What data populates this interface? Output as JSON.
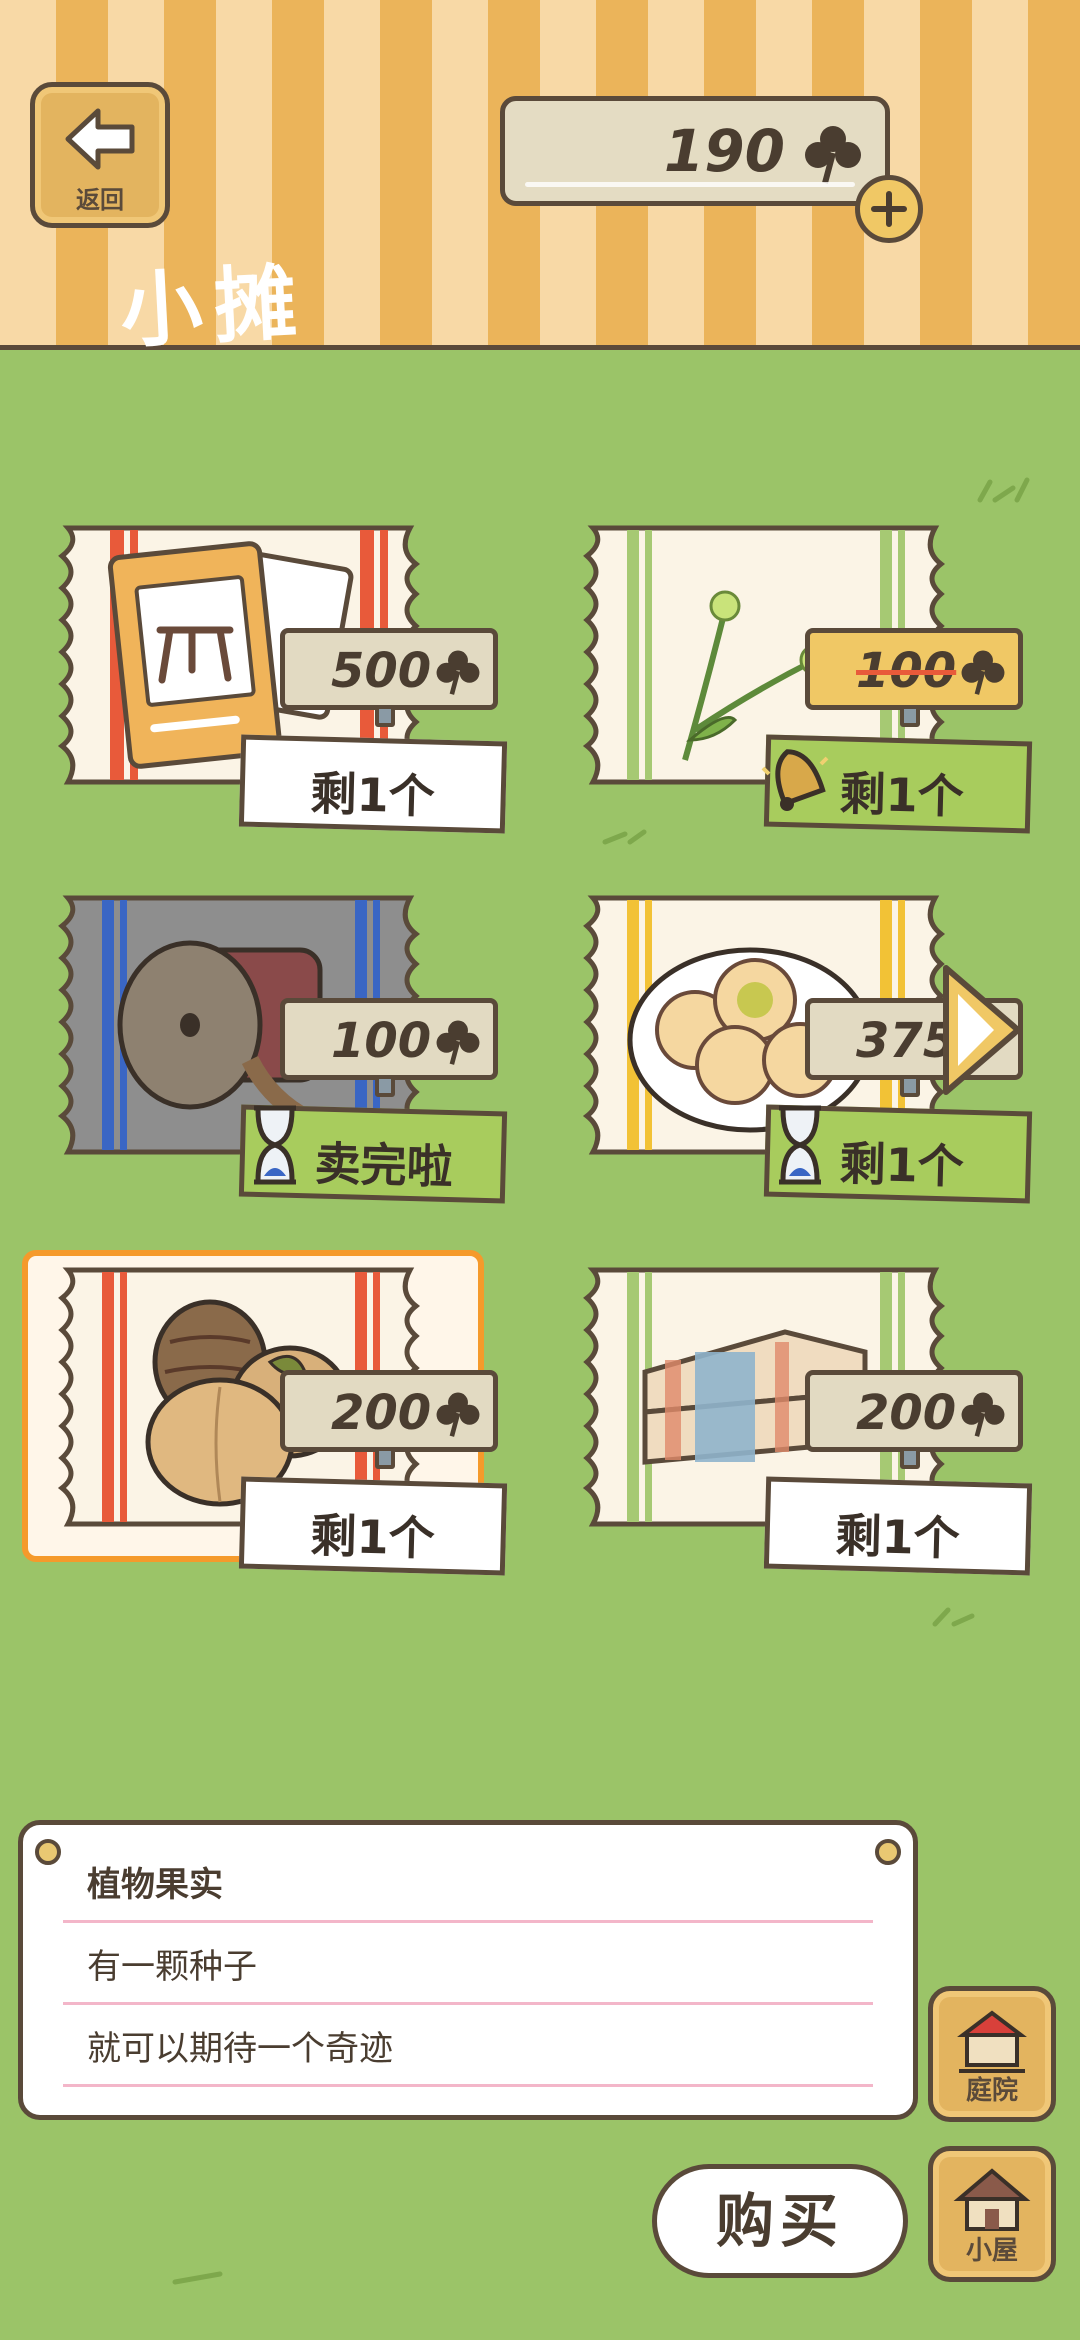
{
  "header": {
    "title": "小摊",
    "back_label": "返回",
    "currency_amount": "190"
  },
  "items": [
    {
      "id": "table-card",
      "price": "500",
      "stock_label": "剩1个",
      "cloth_color": "#e85a3a",
      "on_sale": false,
      "badge": "none",
      "selected": false
    },
    {
      "id": "dandelion",
      "price": "100",
      "stock_label": "剩1个",
      "cloth_color": "#a6c973",
      "on_sale": true,
      "badge": "bell-icon",
      "selected": false
    },
    {
      "id": "radish-wheel",
      "price": "100",
      "stock_label": "卖完啦",
      "cloth_color": "#3a66c4",
      "on_sale": false,
      "badge": "hourglass-icon",
      "selected": false
    },
    {
      "id": "dumplings",
      "price": "375",
      "stock_label": "剩1个",
      "cloth_color": "#f2c236",
      "on_sale": false,
      "badge": "hourglass-icon",
      "selected": false
    },
    {
      "id": "pinecone-fruit",
      "price": "200",
      "stock_label": "剩1个",
      "cloth_color": "#e85a3a",
      "on_sale": false,
      "badge": "none",
      "selected": true
    },
    {
      "id": "cushion",
      "price": "200",
      "stock_label": "剩1个",
      "cloth_color": "#a6c973",
      "on_sale": false,
      "badge": "none",
      "selected": false
    }
  ],
  "info": {
    "title": "植物果实",
    "line1": "有一颗种子",
    "line2": "就可以期待一个奇迹"
  },
  "side": {
    "yard_label": "庭院",
    "house_label": "小屋"
  },
  "buy_label": "购买",
  "colors": {
    "grass": "#9bc468",
    "awning_light": "#f8d9a6",
    "awning_dark": "#ebb45a",
    "wood": "#e3b45f",
    "outline": "#5a4a3a",
    "selected_border": "#f59a2b",
    "sale_tag": "#f0c865",
    "stock_green": "#a8cc5d"
  }
}
